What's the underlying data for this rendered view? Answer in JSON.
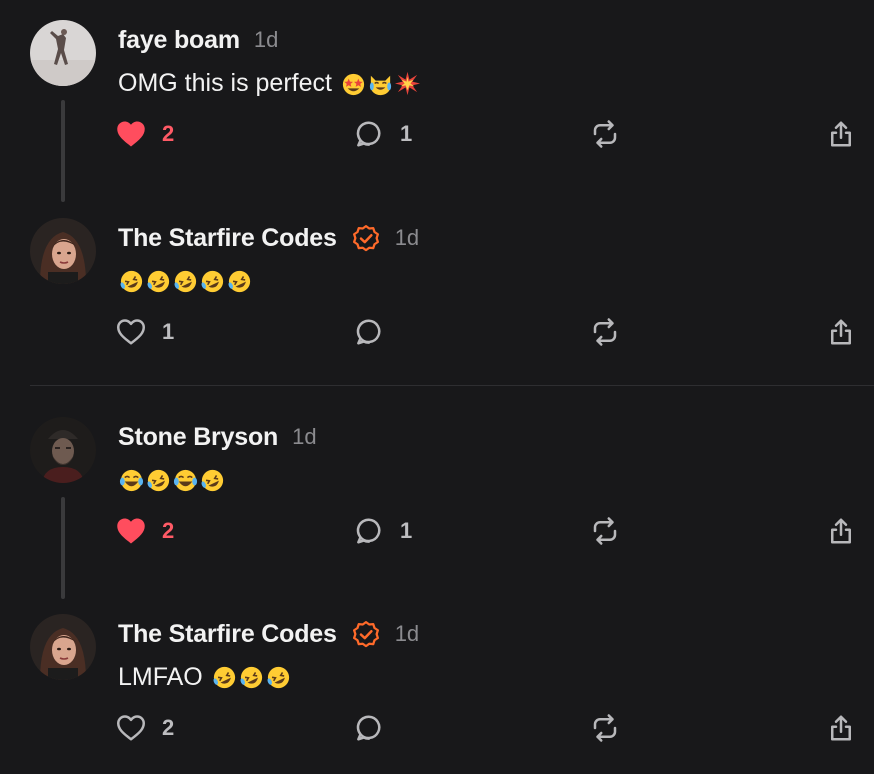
{
  "colors": {
    "background": "#18181a",
    "like_active": "#ff4d5e",
    "verified": "#ff6a2a",
    "muted": "#8b8b8f"
  },
  "posts": [
    {
      "author": "faye boam",
      "time": "1d",
      "verified": false,
      "text": "OMG this is perfect",
      "emoji": [
        "star-struck-emoji",
        "crying-cat-emoji",
        "collision-emoji"
      ],
      "likes": "2",
      "liked": true,
      "replies": "1"
    },
    {
      "author": "The Starfire Codes",
      "time": "1d",
      "verified": true,
      "text": "",
      "emoji": [
        "rofl-emoji",
        "rofl-emoji",
        "rofl-emoji",
        "rofl-emoji",
        "rofl-emoji"
      ],
      "likes": "1",
      "liked": false,
      "replies": ""
    },
    {
      "author": "Stone Bryson",
      "time": "1d",
      "verified": false,
      "text": "",
      "emoji": [
        "joy-emoji",
        "rofl-emoji",
        "joy-emoji",
        "rofl-emoji"
      ],
      "likes": "2",
      "liked": true,
      "replies": "1"
    },
    {
      "author": "The Starfire Codes",
      "time": "1d",
      "verified": true,
      "text": "LMFAO",
      "emoji": [
        "rofl-emoji",
        "rofl-emoji",
        "rofl-emoji"
      ],
      "likes": "2",
      "liked": false,
      "replies": ""
    }
  ]
}
